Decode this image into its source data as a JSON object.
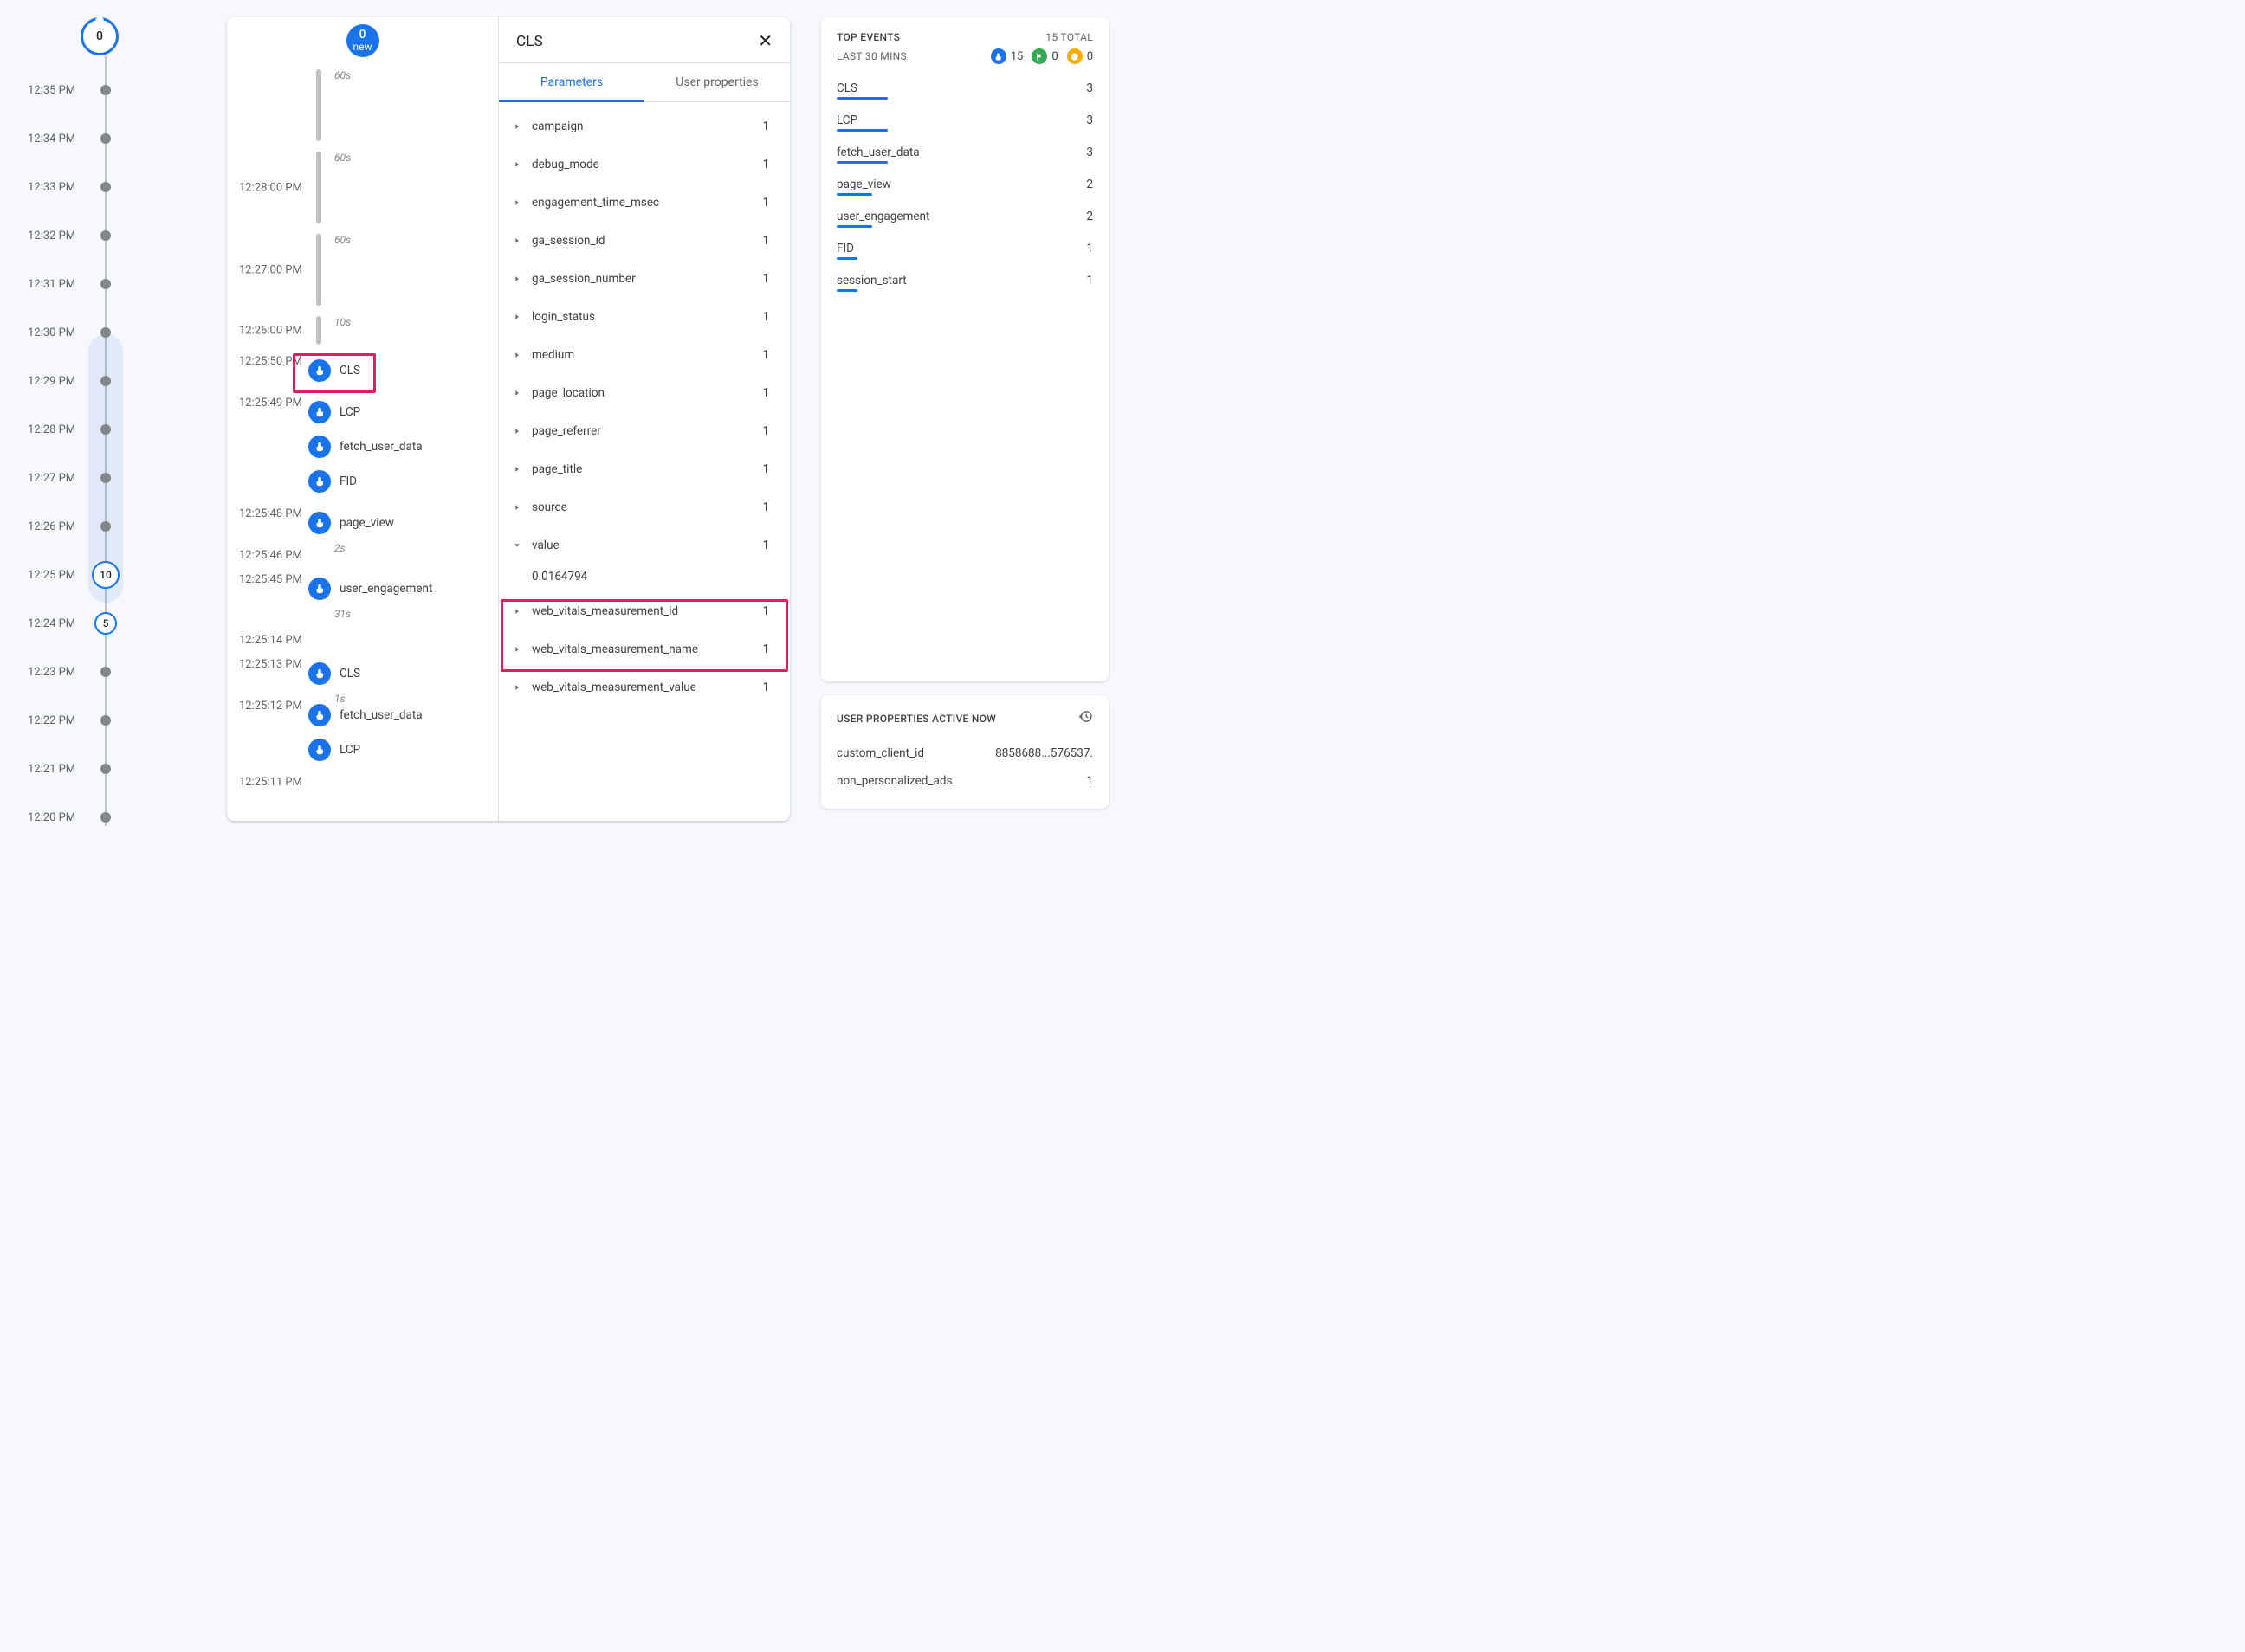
{
  "minimap": {
    "head_count": "0",
    "rows": [
      {
        "time": "12:35 PM",
        "type": "dot"
      },
      {
        "time": "12:34 PM",
        "type": "dot"
      },
      {
        "time": "12:33 PM",
        "type": "dot"
      },
      {
        "time": "12:32 PM",
        "type": "dot"
      },
      {
        "time": "12:31 PM",
        "type": "dot"
      },
      {
        "time": "12:30 PM",
        "type": "dot"
      },
      {
        "time": "12:29 PM",
        "type": "dot"
      },
      {
        "time": "12:28 PM",
        "type": "dot"
      },
      {
        "time": "12:27 PM",
        "type": "dot"
      },
      {
        "time": "12:26 PM",
        "type": "dot"
      },
      {
        "time": "12:25 PM",
        "type": "ring",
        "value": "10"
      },
      {
        "time": "12:24 PM",
        "type": "ring-sm",
        "value": "5"
      },
      {
        "time": "12:23 PM",
        "type": "dot"
      },
      {
        "time": "12:22 PM",
        "type": "dot"
      },
      {
        "time": "12:21 PM",
        "type": "dot"
      },
      {
        "time": "12:20 PM",
        "type": "dot"
      }
    ]
  },
  "stream": {
    "badge_count": "0",
    "badge_label": "new",
    "minutes": [
      {
        "label": "",
        "dur": "60s"
      },
      {
        "label": "12:28:00 PM",
        "dur": "60s"
      },
      {
        "label": "12:27:00 PM",
        "dur": "60s"
      },
      {
        "label": "12:26:00 PM",
        "dur": "10s"
      }
    ],
    "t_12_25_50": "12:25:50 PM",
    "t_12_25_49": "12:25:49 PM",
    "t_12_25_48": "12:25:48 PM",
    "t_12_25_46": "12:25:46 PM",
    "t_12_25_45": "12:25:45 PM",
    "t_12_25_14": "12:25:14 PM",
    "t_12_25_13": "12:25:13 PM",
    "t_12_25_12": "12:25:12 PM",
    "t_12_25_11": "12:25:11 PM",
    "d_2s": "2s",
    "d_31s": "31s",
    "d_1s": "1s",
    "ev": {
      "cls": "CLS",
      "lcp": "LCP",
      "fetch_user_data": "fetch_user_data",
      "fid": "FID",
      "page_view": "page_view",
      "user_engagement": "user_engagement"
    }
  },
  "detail": {
    "title": "CLS",
    "tabs": {
      "parameters": "Parameters",
      "user_properties": "User properties"
    },
    "params": [
      {
        "name": "campaign",
        "count": "1"
      },
      {
        "name": "debug_mode",
        "count": "1"
      },
      {
        "name": "engagement_time_msec",
        "count": "1"
      },
      {
        "name": "ga_session_id",
        "count": "1"
      },
      {
        "name": "ga_session_number",
        "count": "1"
      },
      {
        "name": "login_status",
        "count": "1"
      },
      {
        "name": "medium",
        "count": "1"
      },
      {
        "name": "page_location",
        "count": "1"
      },
      {
        "name": "page_referrer",
        "count": "1"
      },
      {
        "name": "page_title",
        "count": "1"
      },
      {
        "name": "source",
        "count": "1"
      },
      {
        "name": "value",
        "count": "1",
        "expanded_value": "0.0164794"
      },
      {
        "name": "web_vitals_measurement_id",
        "count": "1"
      },
      {
        "name": "web_vitals_measurement_name",
        "count": "1"
      },
      {
        "name": "web_vitals_measurement_value",
        "count": "1"
      }
    ]
  },
  "top_events": {
    "title": "TOP EVENTS",
    "total_label": "15 TOTAL",
    "sub_label": "LAST 30 MINS",
    "pills": {
      "blue": "15",
      "green": "0",
      "orange": "0"
    },
    "items": [
      {
        "name": "CLS",
        "count": "3",
        "bar_pct": 20
      },
      {
        "name": "LCP",
        "count": "3",
        "bar_pct": 20
      },
      {
        "name": "fetch_user_data",
        "count": "3",
        "bar_pct": 20
      },
      {
        "name": "page_view",
        "count": "2",
        "bar_pct": 14
      },
      {
        "name": "user_engagement",
        "count": "2",
        "bar_pct": 14
      },
      {
        "name": "FID",
        "count": "1",
        "bar_pct": 8
      },
      {
        "name": "session_start",
        "count": "1",
        "bar_pct": 8
      }
    ]
  },
  "user_props": {
    "title": "USER PROPERTIES ACTIVE NOW",
    "rows": [
      {
        "name": "custom_client_id",
        "value": "8858688...576537."
      },
      {
        "name": "non_personalized_ads",
        "value": "1"
      }
    ]
  }
}
